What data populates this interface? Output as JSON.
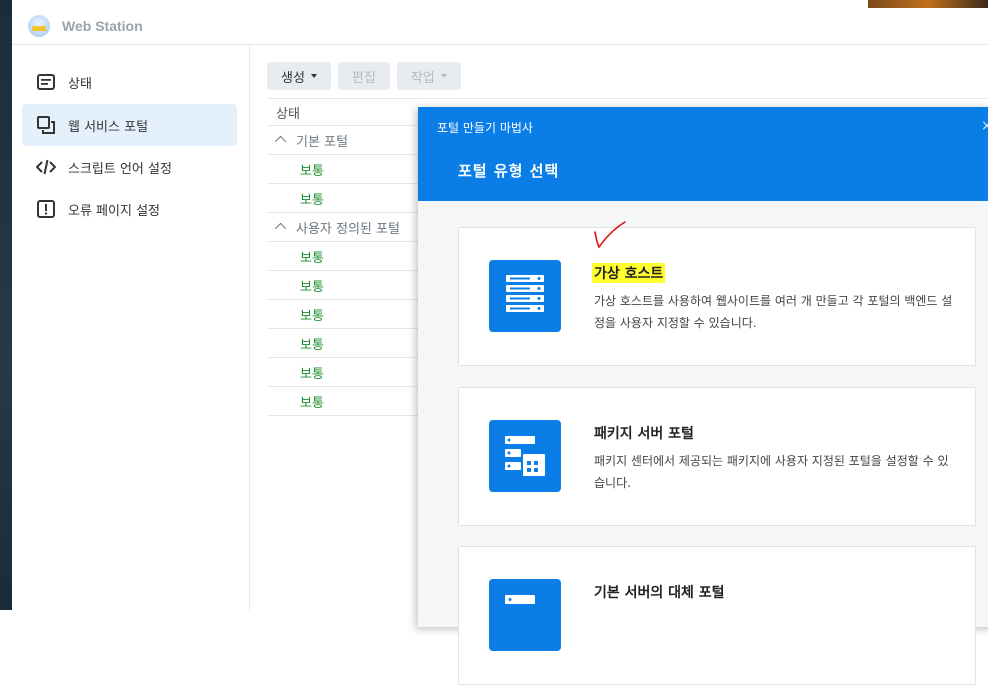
{
  "app": {
    "title": "Web Station"
  },
  "sidebar": {
    "items": [
      {
        "label": "상태",
        "icon": "status-list-icon",
        "active": false
      },
      {
        "label": "웹 서비스 포털",
        "icon": "portal-windows-icon",
        "active": true
      },
      {
        "label": "스크립트 언어 설정",
        "icon": "code-icon",
        "active": false
      },
      {
        "label": "오류 페이지 설정",
        "icon": "error-icon",
        "active": false
      }
    ]
  },
  "toolbar": {
    "create_label": "생성",
    "edit_label": "편집",
    "action_label": "작업"
  },
  "table": {
    "header_status": "상태",
    "groups": [
      {
        "label": "기본 포털",
        "rows": [
          "보통",
          "보통"
        ]
      },
      {
        "label": "사용자 정의된 포털",
        "rows": [
          "보통",
          "보통",
          "보통",
          "보통",
          "보통",
          "보통"
        ]
      }
    ]
  },
  "modal": {
    "subtitle": "포털 만들기 마법사",
    "close": "×",
    "title": "포털 유형 선택",
    "cards": [
      {
        "title": "가상 호스트",
        "desc": "가상 호스트를 사용하여 웹사이트를 여러 개 만들고 각 포털의 백엔드 설정을 사용자 지정할 수 있습니다.",
        "icon": "server-stack-icon",
        "highlight": true
      },
      {
        "title": "패키지 서버 포털",
        "desc": "패키지 센터에서 제공되는 패키지에 사용자 지정된 포털을 설정할 수 있습니다.",
        "icon": "package-server-icon",
        "highlight": false
      },
      {
        "title": "기본 서버의 대체 포털",
        "desc": "",
        "icon": "default-server-icon",
        "highlight": false
      }
    ]
  },
  "colors": {
    "accent": "#0a7ee6",
    "ok": "#1a8f2e",
    "highlight": "#ffff2e",
    "annotation": "#e01010"
  }
}
